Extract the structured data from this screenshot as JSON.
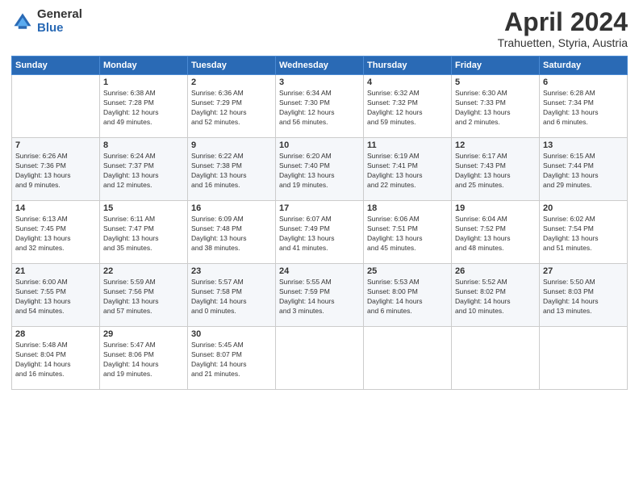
{
  "logo": {
    "general": "General",
    "blue": "Blue"
  },
  "title": "April 2024",
  "location": "Trahuetten, Styria, Austria",
  "weekdays": [
    "Sunday",
    "Monday",
    "Tuesday",
    "Wednesday",
    "Thursday",
    "Friday",
    "Saturday"
  ],
  "weeks": [
    [
      {
        "day": "",
        "info": ""
      },
      {
        "day": "1",
        "info": "Sunrise: 6:38 AM\nSunset: 7:28 PM\nDaylight: 12 hours\nand 49 minutes."
      },
      {
        "day": "2",
        "info": "Sunrise: 6:36 AM\nSunset: 7:29 PM\nDaylight: 12 hours\nand 52 minutes."
      },
      {
        "day": "3",
        "info": "Sunrise: 6:34 AM\nSunset: 7:30 PM\nDaylight: 12 hours\nand 56 minutes."
      },
      {
        "day": "4",
        "info": "Sunrise: 6:32 AM\nSunset: 7:32 PM\nDaylight: 12 hours\nand 59 minutes."
      },
      {
        "day": "5",
        "info": "Sunrise: 6:30 AM\nSunset: 7:33 PM\nDaylight: 13 hours\nand 2 minutes."
      },
      {
        "day": "6",
        "info": "Sunrise: 6:28 AM\nSunset: 7:34 PM\nDaylight: 13 hours\nand 6 minutes."
      }
    ],
    [
      {
        "day": "7",
        "info": "Sunrise: 6:26 AM\nSunset: 7:36 PM\nDaylight: 13 hours\nand 9 minutes."
      },
      {
        "day": "8",
        "info": "Sunrise: 6:24 AM\nSunset: 7:37 PM\nDaylight: 13 hours\nand 12 minutes."
      },
      {
        "day": "9",
        "info": "Sunrise: 6:22 AM\nSunset: 7:38 PM\nDaylight: 13 hours\nand 16 minutes."
      },
      {
        "day": "10",
        "info": "Sunrise: 6:20 AM\nSunset: 7:40 PM\nDaylight: 13 hours\nand 19 minutes."
      },
      {
        "day": "11",
        "info": "Sunrise: 6:19 AM\nSunset: 7:41 PM\nDaylight: 13 hours\nand 22 minutes."
      },
      {
        "day": "12",
        "info": "Sunrise: 6:17 AM\nSunset: 7:43 PM\nDaylight: 13 hours\nand 25 minutes."
      },
      {
        "day": "13",
        "info": "Sunrise: 6:15 AM\nSunset: 7:44 PM\nDaylight: 13 hours\nand 29 minutes."
      }
    ],
    [
      {
        "day": "14",
        "info": "Sunrise: 6:13 AM\nSunset: 7:45 PM\nDaylight: 13 hours\nand 32 minutes."
      },
      {
        "day": "15",
        "info": "Sunrise: 6:11 AM\nSunset: 7:47 PM\nDaylight: 13 hours\nand 35 minutes."
      },
      {
        "day": "16",
        "info": "Sunrise: 6:09 AM\nSunset: 7:48 PM\nDaylight: 13 hours\nand 38 minutes."
      },
      {
        "day": "17",
        "info": "Sunrise: 6:07 AM\nSunset: 7:49 PM\nDaylight: 13 hours\nand 41 minutes."
      },
      {
        "day": "18",
        "info": "Sunrise: 6:06 AM\nSunset: 7:51 PM\nDaylight: 13 hours\nand 45 minutes."
      },
      {
        "day": "19",
        "info": "Sunrise: 6:04 AM\nSunset: 7:52 PM\nDaylight: 13 hours\nand 48 minutes."
      },
      {
        "day": "20",
        "info": "Sunrise: 6:02 AM\nSunset: 7:54 PM\nDaylight: 13 hours\nand 51 minutes."
      }
    ],
    [
      {
        "day": "21",
        "info": "Sunrise: 6:00 AM\nSunset: 7:55 PM\nDaylight: 13 hours\nand 54 minutes."
      },
      {
        "day": "22",
        "info": "Sunrise: 5:59 AM\nSunset: 7:56 PM\nDaylight: 13 hours\nand 57 minutes."
      },
      {
        "day": "23",
        "info": "Sunrise: 5:57 AM\nSunset: 7:58 PM\nDaylight: 14 hours\nand 0 minutes."
      },
      {
        "day": "24",
        "info": "Sunrise: 5:55 AM\nSunset: 7:59 PM\nDaylight: 14 hours\nand 3 minutes."
      },
      {
        "day": "25",
        "info": "Sunrise: 5:53 AM\nSunset: 8:00 PM\nDaylight: 14 hours\nand 6 minutes."
      },
      {
        "day": "26",
        "info": "Sunrise: 5:52 AM\nSunset: 8:02 PM\nDaylight: 14 hours\nand 10 minutes."
      },
      {
        "day": "27",
        "info": "Sunrise: 5:50 AM\nSunset: 8:03 PM\nDaylight: 14 hours\nand 13 minutes."
      }
    ],
    [
      {
        "day": "28",
        "info": "Sunrise: 5:48 AM\nSunset: 8:04 PM\nDaylight: 14 hours\nand 16 minutes."
      },
      {
        "day": "29",
        "info": "Sunrise: 5:47 AM\nSunset: 8:06 PM\nDaylight: 14 hours\nand 19 minutes."
      },
      {
        "day": "30",
        "info": "Sunrise: 5:45 AM\nSunset: 8:07 PM\nDaylight: 14 hours\nand 21 minutes."
      },
      {
        "day": "",
        "info": ""
      },
      {
        "day": "",
        "info": ""
      },
      {
        "day": "",
        "info": ""
      },
      {
        "day": "",
        "info": ""
      }
    ]
  ]
}
